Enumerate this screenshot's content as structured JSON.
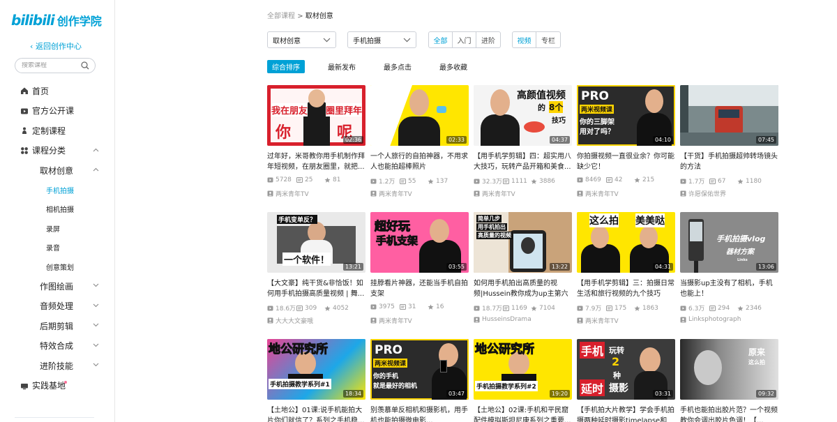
{
  "app": {
    "logo_mark": "bilibili",
    "logo_text": "创作学院"
  },
  "sidebar": {
    "back_label": "返回创作中心",
    "search_placeholder": "搜索课程",
    "items": [
      {
        "label": "首页",
        "icon": "home-icon"
      },
      {
        "label": "官方公开课",
        "icon": "tv-icon"
      },
      {
        "label": "定制课程",
        "icon": "custom-icon"
      },
      {
        "label": "课程分类",
        "icon": "category-icon",
        "expanded": true
      },
      {
        "label": "取材创意",
        "expanded": true
      },
      {
        "label": "手机拍摄",
        "active": true
      },
      {
        "label": "相机拍摄"
      },
      {
        "label": "录屏"
      },
      {
        "label": "录音"
      },
      {
        "label": "创意策划"
      },
      {
        "label": "作图绘画"
      },
      {
        "label": "音频处理"
      },
      {
        "label": "后期剪辑"
      },
      {
        "label": "特效合成"
      },
      {
        "label": "进阶技能"
      },
      {
        "label": "实践基地",
        "icon": "practice-icon"
      }
    ]
  },
  "breadcrumb": {
    "root": "全部课程",
    "sep": ">",
    "current": "取材创意"
  },
  "filters": {
    "category": "取材创意",
    "subcategory": "手机拍摄",
    "levels": [
      "全部",
      "入门",
      "进阶"
    ],
    "types": [
      "视频",
      "专栏"
    ]
  },
  "sorts": [
    "综合排序",
    "最新发布",
    "最多点击",
    "最多收藏"
  ],
  "colors": {
    "accent": "#00a1d6",
    "dot": "#fb7299"
  },
  "videos": [
    {
      "title": "过年好，米哥教你用手机制作拜年短视频，在朋友圈里，就把...",
      "duration": "02:36",
      "views": "5728",
      "danmaku": "25",
      "favs": "81",
      "author": "两米青年TV",
      "thumb_text": [
        "我在朋友",
        "圈里拜年",
        "你",
        "呢"
      ]
    },
    {
      "title": "一个人旅行的自拍神器，不用求人也能拍超棒照片",
      "duration": "02:33",
      "views": "1.2万",
      "danmaku": "55",
      "favs": "137",
      "author": "两米青年TV",
      "thumb_text": []
    },
    {
      "title": "【用手机学剪辑】四：超实用八大技巧，玩转产品开箱和美食...",
      "duration": "04:37",
      "views": "32.3万",
      "danmaku": "1111",
      "favs": "3886",
      "author": "两米青年TV",
      "thumb_text": [
        "高颜值视频",
        "的",
        "8个",
        "技巧"
      ]
    },
    {
      "title": "你拍摄视频一直很业余？你可能缺少它！",
      "duration": "04:10",
      "views": "8469",
      "danmaku": "42",
      "favs": "215",
      "author": "两米青年TV",
      "thumb_text": [
        "PRO",
        "两米视频课",
        "你的三脚架",
        "用对了吗？"
      ]
    },
    {
      "title": "【干货】手机拍摄超帅转场镜头的方法",
      "duration": "07:45",
      "views": "1.7万",
      "danmaku": "67",
      "favs": "1180",
      "author": "许愿保佑世界",
      "thumb_text": []
    },
    {
      "title": "【大文豪】纯干货&非恰饭！如何用手机拍摄高质量视频 | 舞...",
      "duration": "13:21",
      "views": "18.6万",
      "danmaku": "309",
      "favs": "4052",
      "author": "大大大文豪哦",
      "thumb_text": [
        "手机变单反？",
        "一个软件！"
      ]
    },
    {
      "title": "挂脖看片神器，还能当手机自拍支架",
      "duration": "03:55",
      "views": "3975",
      "danmaku": "31",
      "favs": "16",
      "author": "两米青年TV",
      "thumb_text": [
        "超好玩",
        "手机支架"
      ]
    },
    {
      "title": "如何用手机拍出高质量的视频|Hussein教你成为up主第六期",
      "duration": "13:22",
      "views": "18.7万",
      "danmaku": "1169",
      "favs": "7104",
      "author": "HusseinsDrama",
      "thumb_text": [
        "简单几步",
        "用手机拍出",
        "高质量的视频"
      ]
    },
    {
      "title": "【用手机学剪辑】三：拍摄日常生活和旅行视频的九个技巧",
      "duration": "04:31",
      "views": "7.9万",
      "danmaku": "175",
      "favs": "1863",
      "author": "两米青年TV",
      "thumb_text": [
        "这么拍",
        "美美哒"
      ]
    },
    {
      "title": "当摄影up主没有了相机，手机也能上！",
      "duration": "13:06",
      "views": "6.3万",
      "danmaku": "294",
      "favs": "2346",
      "author": "Linksphotograph",
      "thumb_text": [
        "手机拍摄vlog",
        "器材方案",
        "Links"
      ]
    },
    {
      "title": "【土地公】01课:说手机能拍大片你们就信了？系列之手机稳...",
      "duration": "18:34",
      "thumb_text": [
        "地公研究所",
        "手机拍摄教学系列#1"
      ]
    },
    {
      "title": "别羡慕单反相机和摄影机，用手机也能拍摄微电影...",
      "duration": "03:47",
      "thumb_text": [
        "PRO",
        "两米视频课",
        "你的手机",
        "就是最好的相机"
      ]
    },
    {
      "title": "【土地公】02课:手机和平民窟配件模拟斯坦尼康系列之重要...",
      "duration": "19:20",
      "thumb_text": [
        "地公研究所",
        "手机拍摄教学系列#2"
      ]
    },
    {
      "title": "【手机拍大片教学】学会手机拍摄两种延时摄影timelapse和h...",
      "duration": "03:31",
      "thumb_text": [
        "手机",
        "玩转",
        "2",
        "种",
        "延时",
        "摄影"
      ]
    },
    {
      "title": "手机也能拍出胶片范？一个视频教你会调出胶片色调！【...",
      "duration": "09:32",
      "thumb_text": [
        "原来",
        "这么拍"
      ]
    }
  ]
}
